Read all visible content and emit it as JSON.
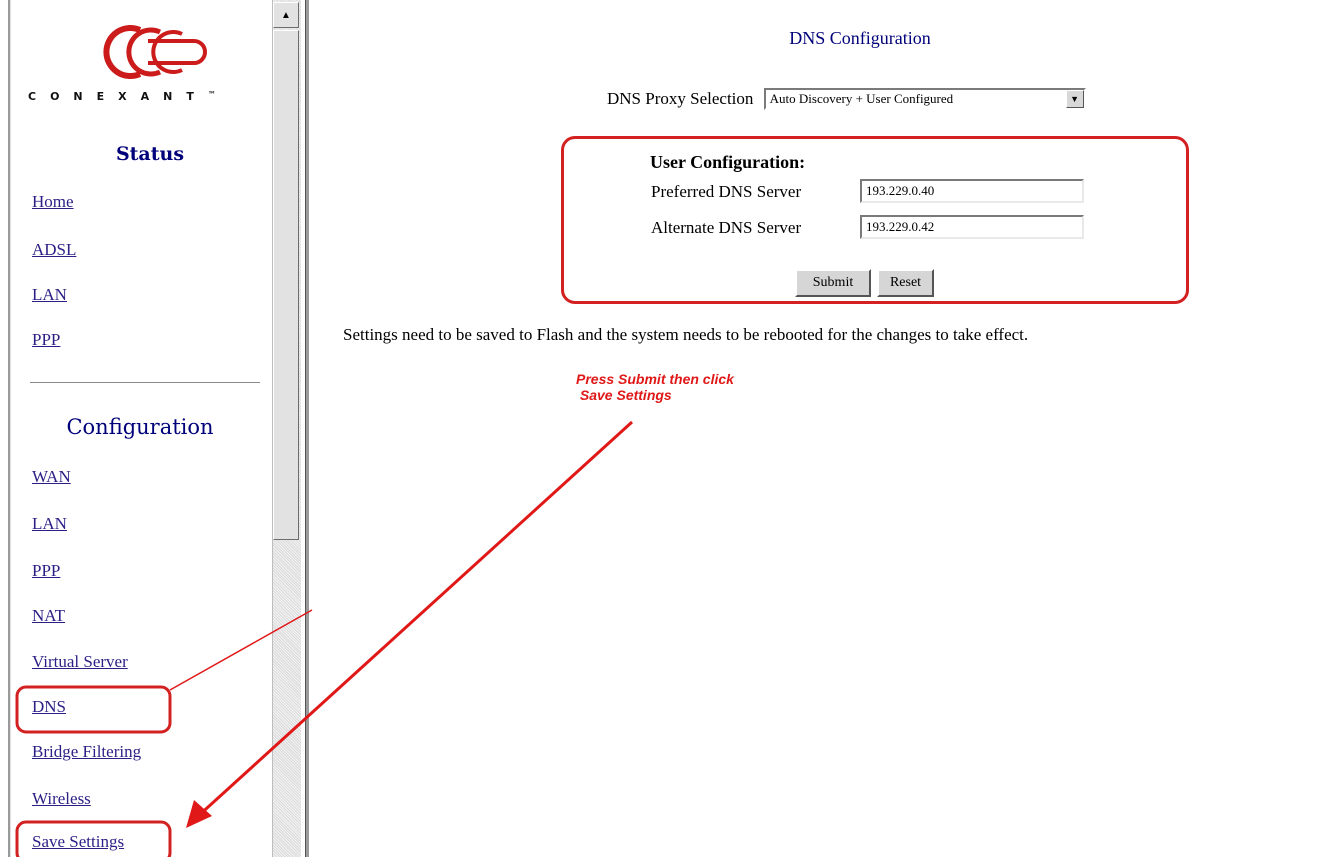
{
  "colors": {
    "nav_link": "#2b1f86",
    "heading": "#00007a",
    "annotation": "#e01818"
  },
  "sidebar": {
    "logo_text": "CONEXANT",
    "logo_tm": "™",
    "status_title": "Status",
    "status_items": [
      {
        "label": "Home"
      },
      {
        "label": "ADSL"
      },
      {
        "label": "LAN"
      },
      {
        "label": "PPP"
      }
    ],
    "configuration_title": "Configuration",
    "config_items": [
      {
        "label": "WAN"
      },
      {
        "label": "LAN"
      },
      {
        "label": "PPP"
      },
      {
        "label": "NAT"
      },
      {
        "label": "Virtual Server"
      },
      {
        "label": "DNS"
      },
      {
        "label": "Bridge Filtering"
      },
      {
        "label": "Wireless"
      },
      {
        "label": "Save Settings"
      }
    ]
  },
  "main": {
    "title": "DNS Configuration",
    "proxy_label": "DNS Proxy Selection",
    "proxy_selected": "Auto Discovery + User Configured",
    "user_config_heading": "User Configuration:",
    "preferred_label": "Preferred DNS Server",
    "preferred_value": "193.229.0.40",
    "alternate_label": "Alternate DNS Server",
    "alternate_value": "193.229.0.42",
    "submit_label": "Submit",
    "reset_label": "Reset",
    "note": "Settings need to be saved to Flash and the system needs to be rebooted for the changes to take effect."
  },
  "annotation": {
    "text": "Press Submit then click\n Save Settings"
  }
}
